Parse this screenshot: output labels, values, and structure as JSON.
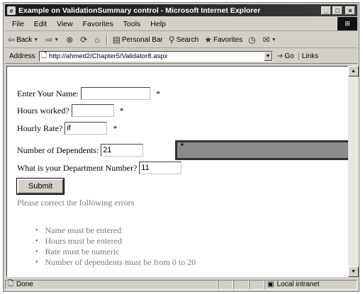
{
  "window": {
    "title": "Example on ValidationSummary control - Microsoft Internet Explorer",
    "minimize_glyph": "_",
    "maximize_glyph": "□",
    "close_glyph": "×"
  },
  "menu": [
    "File",
    "Edit",
    "View",
    "Favorites",
    "Tools",
    "Help"
  ],
  "toolbar": {
    "back": "Back",
    "search": "Search",
    "favorites": "Favorites",
    "personal_bar": "Personal Bar"
  },
  "address": {
    "label": "Address",
    "url": "http://ahmed2/Chapter5/Validator8.aspx",
    "go": "Go",
    "links": "Links"
  },
  "form": {
    "name_label": "Enter Your Name:",
    "name_value": "",
    "hours_label": "Hours worked?",
    "hours_value": "",
    "rate_label": "Hourly Rate?",
    "rate_value": "if",
    "dependents_label": "Number of Dependents:",
    "dependents_value": "21",
    "dept_label": "What is your Department Number?",
    "dept_value": "11",
    "required_marker": "*",
    "summary_marker": "*",
    "submit_label": "Submit"
  },
  "errors": {
    "heading": "Please correct the following errors",
    "items": [
      "Name must be entered",
      "Hours must be entered",
      "Rate must be numeric",
      "Number of dependents must be from 0 to 20"
    ]
  },
  "status": {
    "text": "Done",
    "zone": "Local intranet"
  }
}
